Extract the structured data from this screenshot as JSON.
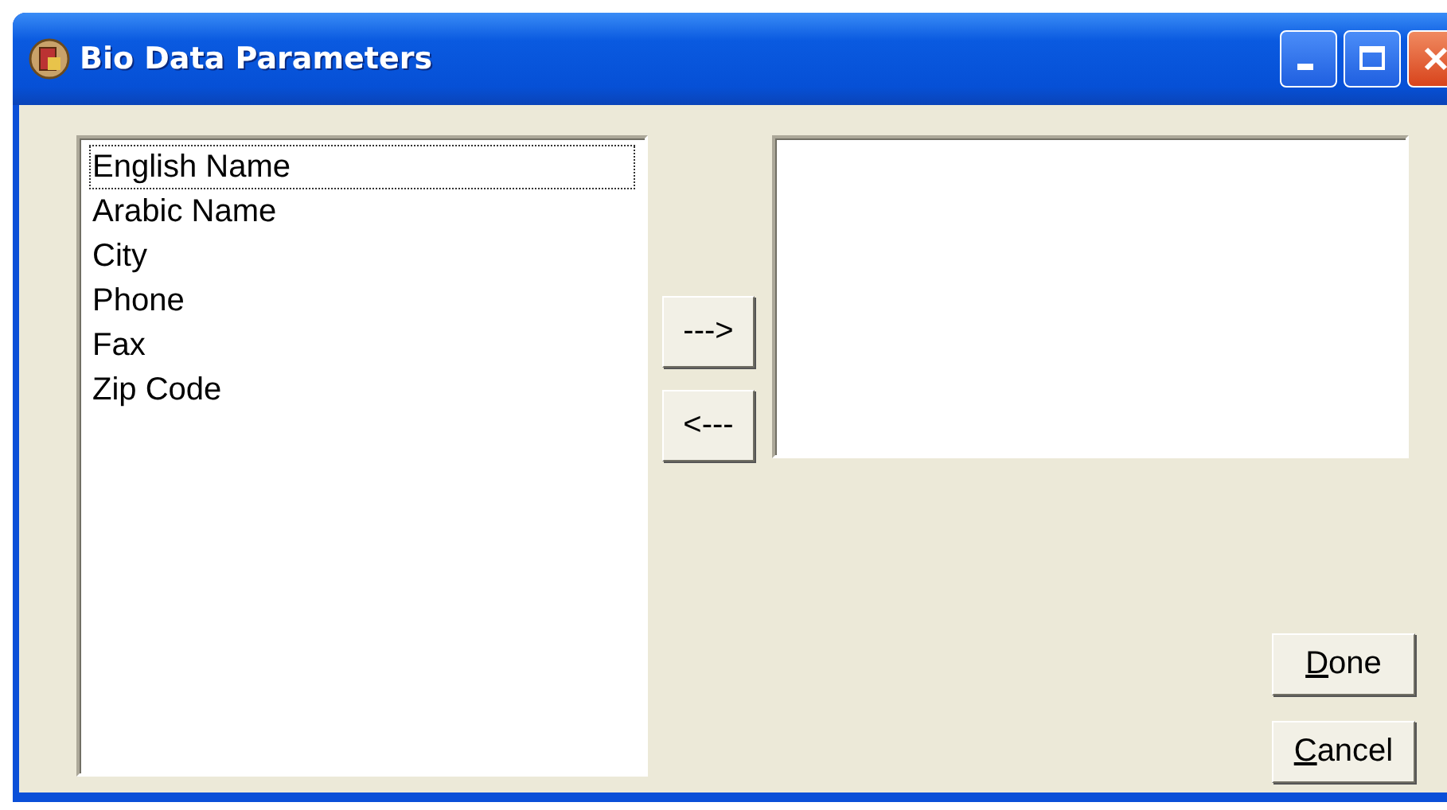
{
  "window": {
    "title": "Bio Data Parameters"
  },
  "available_list": {
    "items": [
      {
        "label": "English Name",
        "focused": true
      },
      {
        "label": "Arabic Name",
        "focused": false
      },
      {
        "label": "City",
        "focused": false
      },
      {
        "label": "Phone",
        "focused": false
      },
      {
        "label": "Fax",
        "focused": false
      },
      {
        "label": "Zip Code",
        "focused": false
      }
    ]
  },
  "move_buttons": [
    {
      "label": "--->"
    },
    {
      "label": "<---"
    }
  ],
  "dialog_buttons": [
    {
      "label": "Done",
      "access_key_underlined": true
    },
    {
      "label": "Cancel",
      "access_key_underlined": true
    }
  ]
}
